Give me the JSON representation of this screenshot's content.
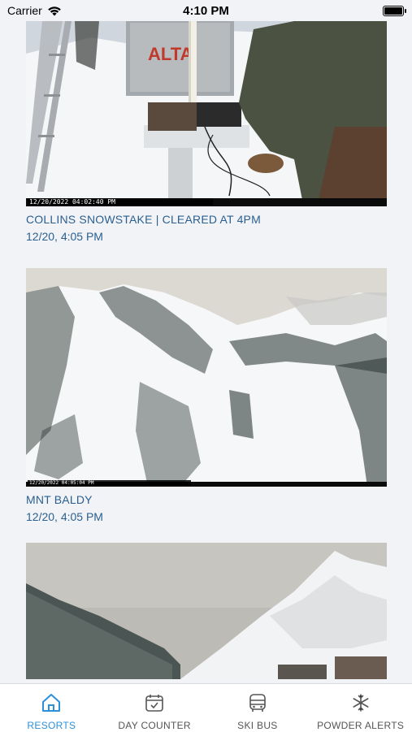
{
  "status_bar": {
    "carrier": "Carrier",
    "time": "4:10 PM"
  },
  "cameras": [
    {
      "title": "COLLINS SNOWSTAKE | CLEARED AT 4PM",
      "time": "12/20, 4:05 PM",
      "stamp": "12/20/2022 04:02:40 PM",
      "sign": "ALTA"
    },
    {
      "title": "MNT BALDY",
      "time": "12/20, 4:05 PM",
      "stamp": "12/20/2022 04:05:04 PM"
    },
    {
      "title": "",
      "time": ""
    }
  ],
  "tab_bar": {
    "active_color": "#2c8fd8",
    "tabs": [
      {
        "label": "RESORTS",
        "icon": "home-icon",
        "active": true
      },
      {
        "label": "DAY COUNTER",
        "icon": "calendar-check-icon",
        "active": false
      },
      {
        "label": "SKI BUS",
        "icon": "bus-icon",
        "active": false
      },
      {
        "label": "POWDER ALERTS",
        "icon": "snowflake-icon",
        "active": false
      }
    ]
  }
}
